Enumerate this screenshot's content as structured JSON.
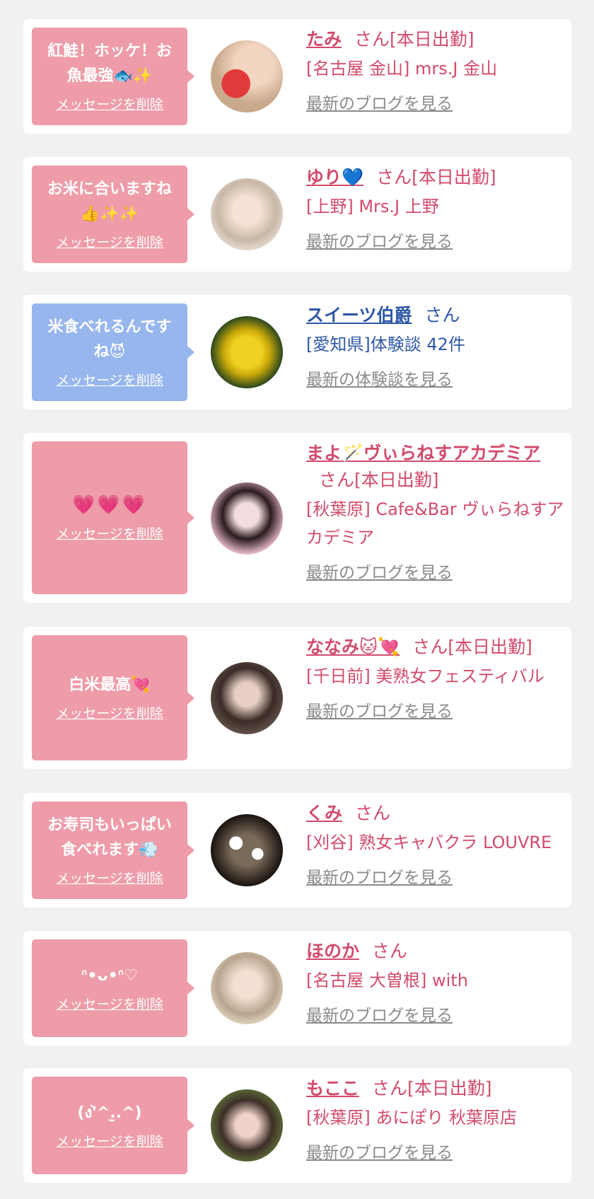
{
  "delete_label": "メッセージを削除",
  "colors": {
    "pink_bubble": "#ee9ca9",
    "blue_bubble": "#97b6ee",
    "pink_text": "#d24b6b",
    "blue_text": "#2f58a6",
    "link_gray": "#8a8a8a"
  },
  "items": [
    {
      "message": "紅鮭！ホッケ！お魚最強🐟✨",
      "name": "たみ",
      "suffix": "さん[本日出勤]",
      "shop": "[名古屋 金山] mrs.J 金山",
      "link": "最新のブログを見る"
    },
    {
      "message": "お米に合いますね👍✨✨",
      "name": "ゆり💙",
      "suffix": "さん[本日出勤]",
      "shop": "[上野] Mrs.J 上野",
      "link": "最新のブログを見る"
    },
    {
      "message": "米食べれるんですね😈",
      "name": "スイーツ伯爵",
      "suffix": "さん",
      "shop": "[愛知県]体験談 42件",
      "link": "最新の体験談を見る"
    },
    {
      "message": "💗💗💗",
      "name": "まよ🪄ヴぃらねすアカデミア",
      "suffix": "さん[本日出勤]",
      "shop": "[秋葉原] Cafe&Bar ヴぃらねすアカデミア",
      "link": "最新のブログを見る"
    },
    {
      "message": "白米最高💘",
      "name": "ななみ🐱💘",
      "suffix": "さん[本日出勤]",
      "shop": "[千日前] 美熟女フェスティバル",
      "link": "最新のブログを見る"
    },
    {
      "message": "お寿司もいっぱい食べれます💨",
      "name": "くみ",
      "suffix": "さん",
      "shop": "[刈谷] 熟女キャバクラ LOUVRE",
      "link": "最新のブログを見る"
    },
    {
      "message": "ᐢ•ᴗ•ᐢ♡",
      "name": "ほのか",
      "suffix": "さん",
      "shop": "[名古屋 大曽根] with",
      "link": "最新のブログを見る"
    },
    {
      "message": "(ง'̀^.̫.^)",
      "name": "もここ",
      "suffix": "さん[本日出勤]",
      "shop": "[秋葉原] あにぽり 秋葉原店",
      "link": "最新のブログを見る"
    }
  ]
}
